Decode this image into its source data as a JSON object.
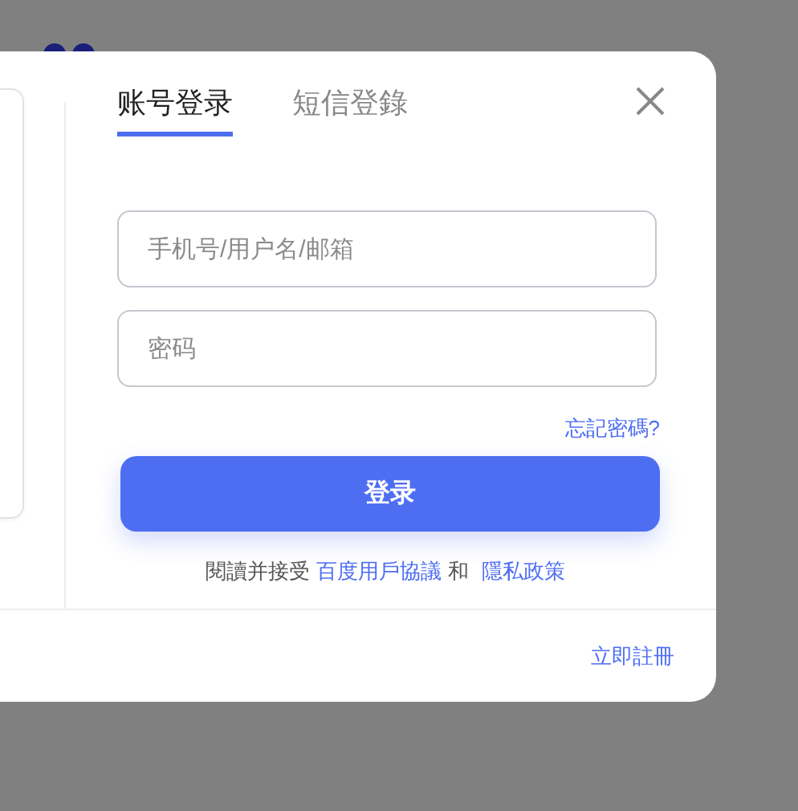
{
  "tabs": [
    {
      "label": "账号登录",
      "selected": true
    },
    {
      "label": "短信登錄",
      "selected": false
    }
  ],
  "fields": [
    {
      "placeholder": "手机号/用户名/邮箱"
    },
    {
      "placeholder": "密码"
    }
  ],
  "forgot_link": "忘記密碼?",
  "login_button": "登录",
  "agreement": {
    "text": "閱讀并接受",
    "links": [
      "百度用戶協議",
      "隱私政策"
    ],
    "joiner": "和"
  },
  "register_link": "立即註冊"
}
